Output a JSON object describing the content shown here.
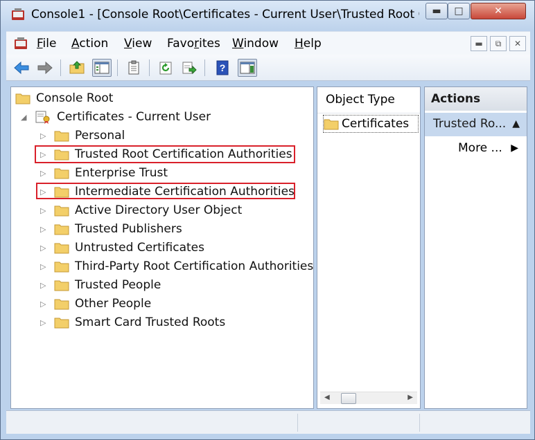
{
  "window": {
    "title": "Console1 - [Console Root\\Certificates - Current User\\Trusted Root C..."
  },
  "menu": {
    "items": [
      {
        "label": "File",
        "key": "F",
        "rest": "ile"
      },
      {
        "label": "Action",
        "key": "A",
        "rest": "ction"
      },
      {
        "label": "View",
        "key": "V",
        "rest": "iew"
      },
      {
        "label": "Favorites",
        "pre": "Favo",
        "key": "r",
        "rest": "ites"
      },
      {
        "label": "Window",
        "key": "W",
        "rest": "indow"
      },
      {
        "label": "Help",
        "key": "H",
        "rest": "elp"
      }
    ]
  },
  "toolbar": {
    "buttons": [
      "back-icon",
      "forward-icon",
      "up-folder-icon",
      "show-hide-tree-icon",
      "properties-icon",
      "refresh-icon",
      "export-list-icon",
      "help-icon",
      "show-hide-action-pane-icon"
    ]
  },
  "tree": {
    "root": "Console Root",
    "store": "Certificates - Current User",
    "items": [
      "Personal",
      "Trusted Root Certification Authorities",
      "Enterprise Trust",
      "Intermediate Certification Authorities",
      "Active Directory User Object",
      "Trusted Publishers",
      "Untrusted Certificates",
      "Third-Party Root Certification Authorities",
      "Trusted People",
      "Other People",
      "Smart Card Trusted Roots"
    ],
    "highlighted": [
      "Trusted Root Certification Authorities",
      "Intermediate Certification Authorities"
    ]
  },
  "list": {
    "header": "Object Type",
    "items": [
      "Certificates"
    ]
  },
  "actions": {
    "header": "Actions",
    "section": "Trusted Ro...",
    "more": "More ..."
  },
  "colors": {
    "highlight_border": "#d9202a",
    "folder": "#f3cf69",
    "actions_section": "#c6d8ee"
  }
}
